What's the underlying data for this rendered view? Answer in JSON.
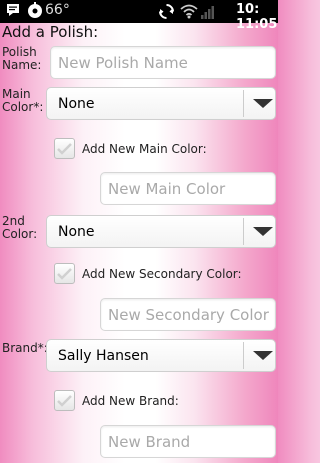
{
  "status_bar": {
    "temperature": "66°",
    "time": "10:11:05",
    "time_display": "10: 11:05",
    "icons": [
      "message-icon",
      "weather-icon",
      "sync-icon",
      "wifi-icon",
      "signal-icon",
      "battery-icon"
    ]
  },
  "form": {
    "title": "Add a Polish:",
    "polish_name": {
      "label": "Polish Name:",
      "placeholder": "New Polish Name"
    },
    "main_color": {
      "label": "Main Color*:",
      "selected": "None",
      "add_new_label": "Add New Main Color:",
      "add_new_checked": false,
      "new_placeholder": "New Main Color"
    },
    "second_color": {
      "label": "2nd Color:",
      "selected": "None",
      "add_new_label": "Add New Secondary Color:",
      "add_new_checked": false,
      "new_placeholder": "New Secondary Color"
    },
    "brand": {
      "label": "Brand*:",
      "selected": "Sally Hansen",
      "add_new_label": "Add New Brand:",
      "add_new_checked": false,
      "new_placeholder": "New Brand"
    }
  },
  "colors": {
    "accent_pink": "#ef86bc",
    "status_bar_bg": "#000000",
    "placeholder_text": "#a9a9a9"
  }
}
